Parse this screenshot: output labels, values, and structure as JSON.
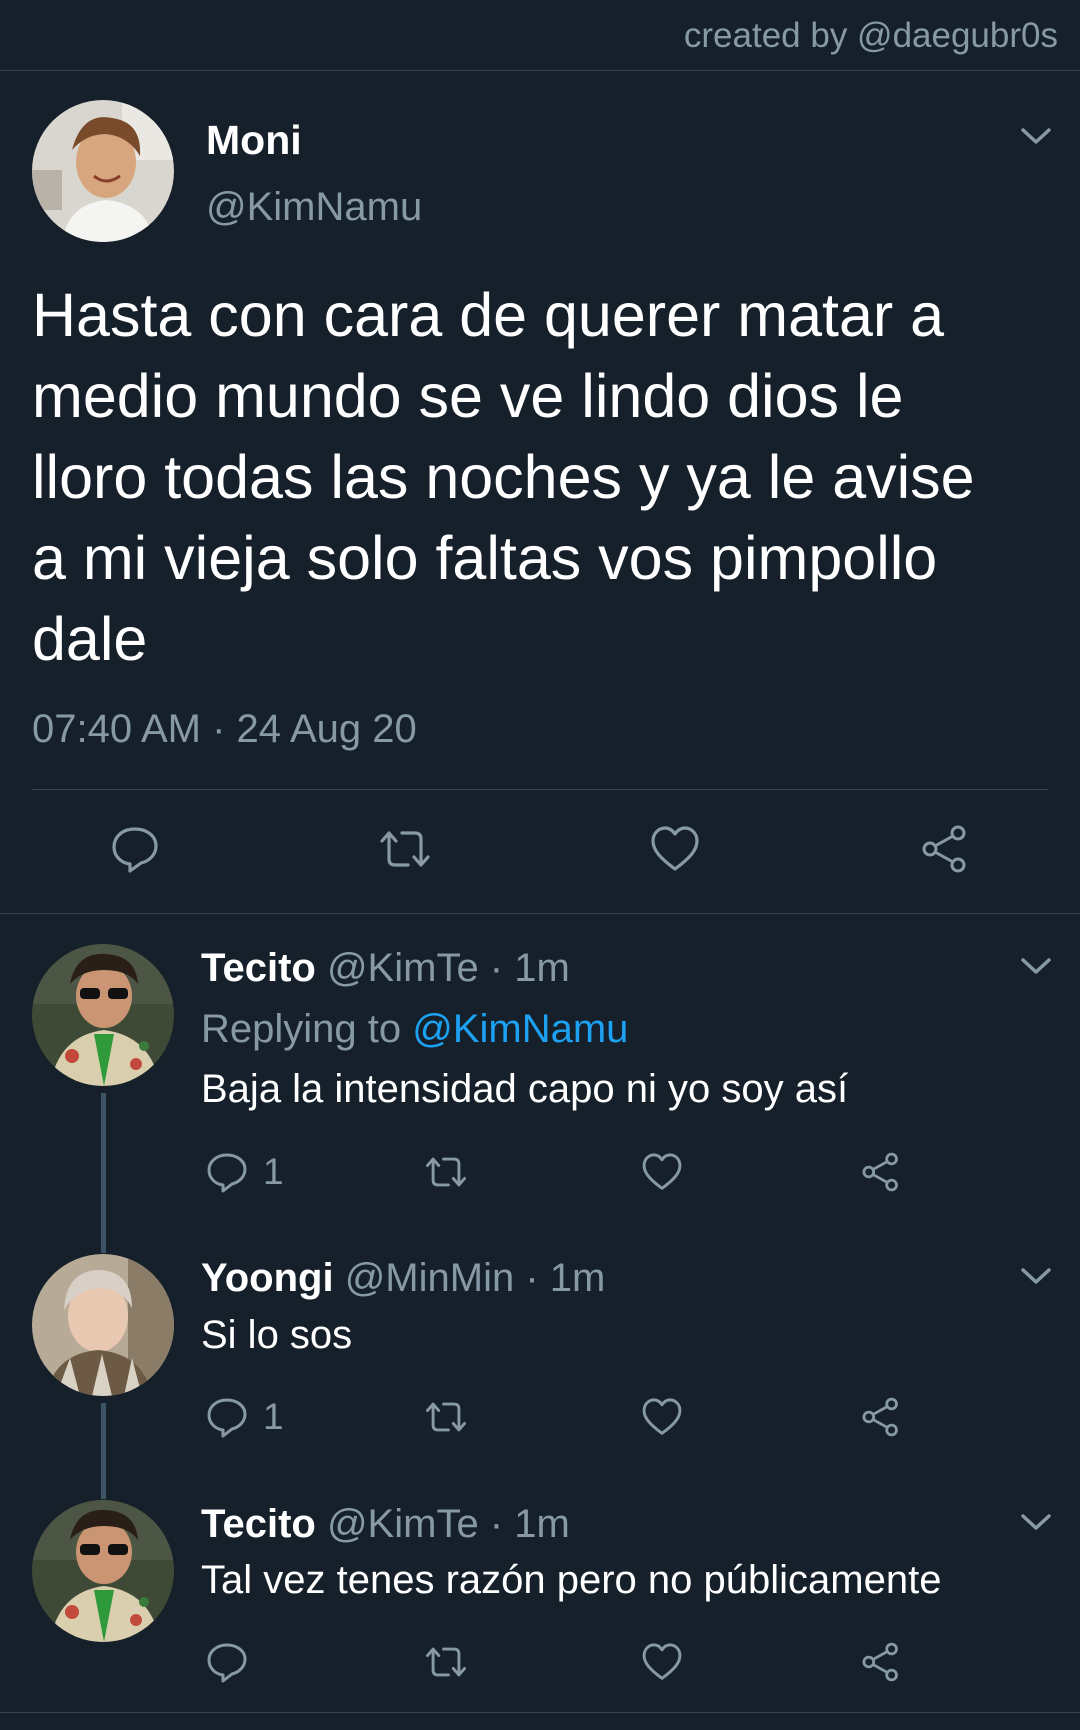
{
  "watermark": "created by @daegubr0s",
  "main_tweet": {
    "display_name": "Moni",
    "handle": "@KimNamu",
    "text": "Hasta con cara de querer matar a\nmedio mundo se ve lindo dios le\nlloro todas las noches y ya le avise\na mi vieja solo faltas vos pimpollo\ndale",
    "timestamp": "07:40 AM · 24 Aug 20"
  },
  "replies": [
    {
      "display_name": "Tecito",
      "meta": "@KimTe · 1m",
      "replying_label": "Replying to ",
      "replying_to": "@KimNamu",
      "text": "Baja la intensidad capo ni yo soy así",
      "reply_count": "1"
    },
    {
      "display_name": "Yoongi",
      "meta": "@MinMin · 1m",
      "text": "Si lo sos",
      "reply_count": "1"
    },
    {
      "display_name": "Tecito",
      "meta": "@KimTe · 1m",
      "text": "Tal vez tenes razón pero no públicamente"
    }
  ],
  "icons": {
    "reply": "reply-icon",
    "retweet": "retweet-icon",
    "like": "heart-icon",
    "share": "share-icon",
    "menu": "chevron-down-icon"
  },
  "colors": {
    "background": "#15202b",
    "divider": "#38444d",
    "secondary_text": "#8899a6",
    "accent": "#1da1f2",
    "thread_line": "#3d5466"
  }
}
